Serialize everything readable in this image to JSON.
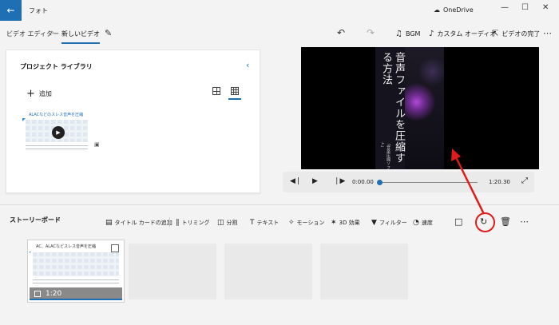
{
  "window": {
    "app_title": "フォト",
    "onedrive_label": "OneDrive"
  },
  "toolbar": {
    "breadcrumb_parent": "ビデオ エディター",
    "breadcrumb_current": "新しいビデオ",
    "bgm_label": "BGM",
    "custom_audio_label": "カスタム オーディオ",
    "finish_label": "ビデオの完了"
  },
  "library": {
    "title": "プロジェクト ライブラリ",
    "add_label": "追加",
    "thumbnail_caption": "ALACなどのスレス音声を圧縮"
  },
  "player": {
    "poster_title": "音声ファイルを圧縮する方法",
    "poster_subtitle": "「音楽圧縮ソフト」",
    "current_time": "0:00.00",
    "total_time": "1:20.30",
    "progress": 0.0
  },
  "storyboard": {
    "title": "ストーリーボード",
    "tools": {
      "title_card": "タイトル カードの追加",
      "trim": "トリミング",
      "split": "分割",
      "text": "テキスト",
      "motion": "モーション",
      "effects_3d": "3D 効果",
      "filter": "フィルター",
      "speed": "速度"
    },
    "clip": {
      "caption": "AC、ALACなどスレス音声を圧縮",
      "duration": "1:20"
    }
  },
  "colors": {
    "accent": "#1f6fb5",
    "annotation": "#e01b1b"
  }
}
